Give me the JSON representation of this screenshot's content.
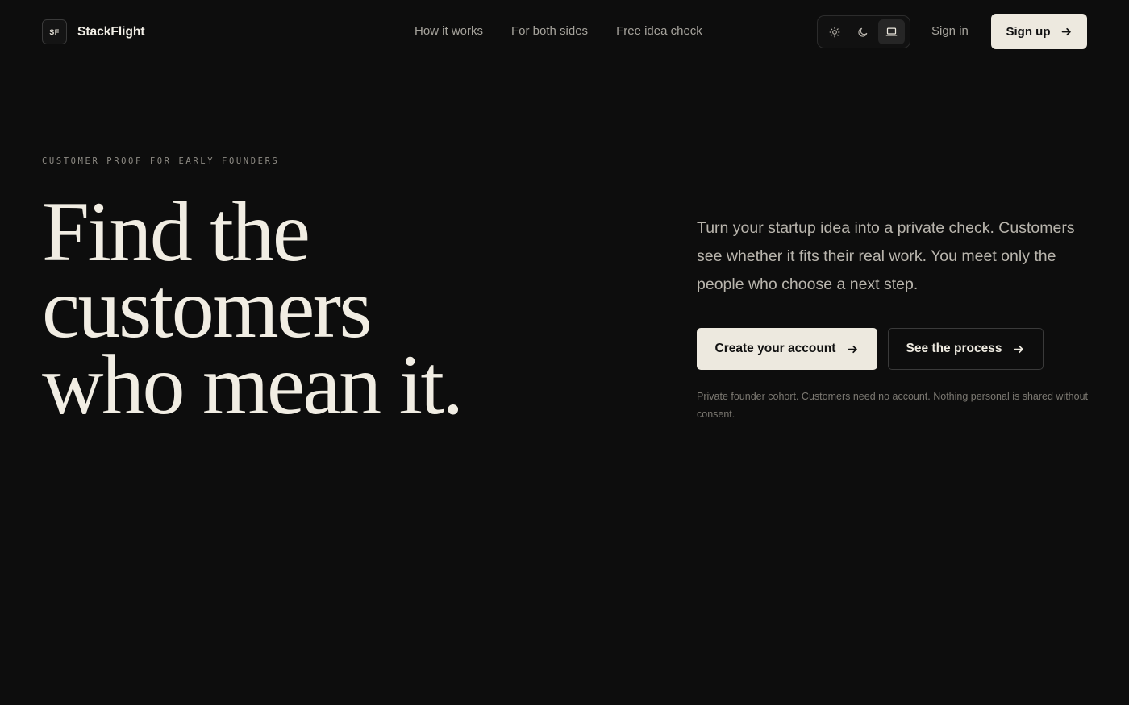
{
  "header": {
    "logo_text": "SF",
    "brand_name": "StackFlight",
    "nav": [
      {
        "label": "How it works"
      },
      {
        "label": "For both sides"
      },
      {
        "label": "Free idea check"
      }
    ],
    "theme_toggle": {
      "options": [
        "sun-icon",
        "moon-icon",
        "laptop-icon"
      ],
      "active": "laptop-icon"
    },
    "signin_label": "Sign in",
    "signup_label": "Sign up"
  },
  "hero": {
    "eyebrow": "CUSTOMER PROOF FOR EARLY FOUNDERS",
    "headline_lines": [
      "Find the",
      "customers",
      "who mean it."
    ],
    "lede": "Turn your startup idea into a private check. Customers see whether it fits their real work. You meet only the people who choose a next step.",
    "primary_cta": "Create your account",
    "secondary_cta": "See the process",
    "note": "Private founder cohort. Customers need no account. Nothing personal is shared without consent."
  },
  "colors": {
    "background": "#0d0d0d",
    "text": "#f1ede3",
    "button_fill": "#ede9df",
    "muted": "#a6a39c"
  }
}
